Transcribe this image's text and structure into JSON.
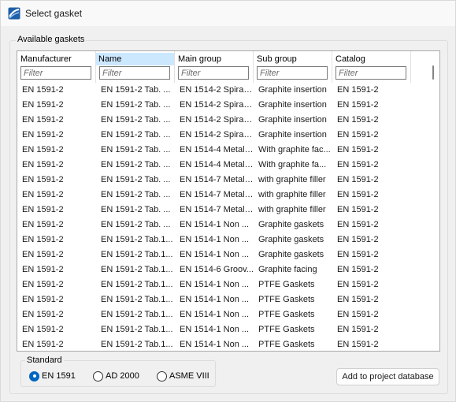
{
  "window": {
    "title": "Select gasket"
  },
  "group": {
    "label": "Available gaskets"
  },
  "columns": [
    {
      "label": "Manufacturer",
      "filter_placeholder": "Filter"
    },
    {
      "label": "Name",
      "filter_placeholder": "Filter"
    },
    {
      "label": "Main group",
      "filter_placeholder": "Filter"
    },
    {
      "label": "Sub group",
      "filter_placeholder": "Filter"
    },
    {
      "label": "Catalog",
      "filter_placeholder": "Filter"
    }
  ],
  "rows": [
    [
      "EN 1591-2",
      "EN 1591-2 Tab. ...",
      "EN 1514-2 Spiral ...",
      "Graphite insertion",
      "EN 1591-2"
    ],
    [
      "EN 1591-2",
      "EN 1591-2 Tab. ...",
      "EN 1514-2 Spiral ...",
      "Graphite insertion",
      "EN 1591-2"
    ],
    [
      "EN 1591-2",
      "EN 1591-2 Tab. ...",
      "EN 1514-2 Spiral ...",
      "Graphite insertion",
      "EN 1591-2"
    ],
    [
      "EN 1591-2",
      "EN 1591-2 Tab. ...",
      "EN 1514-2 Spiral ...",
      "Graphite insertion",
      "EN 1591-2"
    ],
    [
      "EN 1591-2",
      "EN 1591-2 Tab. ...",
      "EN 1514-4 Metal ...",
      "With graphite fac...",
      "EN 1591-2"
    ],
    [
      "EN 1591-2",
      "EN 1591-2 Tab. ...",
      "EN 1514-4 Metal ...",
      "With graphite fa...",
      "EN 1591-2"
    ],
    [
      "EN 1591-2",
      "EN 1591-2 Tab. ...",
      "EN 1514-7 Metal ...",
      "with graphite filler",
      "EN 1591-2"
    ],
    [
      "EN 1591-2",
      "EN 1591-2 Tab. ...",
      "EN 1514-7 Metal ...",
      "with graphite filler",
      "EN 1591-2"
    ],
    [
      "EN 1591-2",
      "EN 1591-2 Tab. ...",
      "EN 1514-7 Metal ...",
      "with graphite filler",
      "EN 1591-2"
    ],
    [
      "EN 1591-2",
      "EN 1591-2 Tab. ...",
      "EN 1514-1 Non ...",
      "Graphite gaskets",
      "EN 1591-2"
    ],
    [
      "EN 1591-2",
      "EN 1591-2 Tab.1...",
      "EN 1514-1 Non ...",
      "Graphite gaskets",
      "EN 1591-2"
    ],
    [
      "EN 1591-2",
      "EN 1591-2 Tab.1...",
      "EN 1514-1 Non ...",
      "Graphite gaskets",
      "EN 1591-2"
    ],
    [
      "EN 1591-2",
      "EN 1591-2 Tab.1...",
      "EN 1514-6 Groov...",
      "Graphite facing",
      "EN 1591-2"
    ],
    [
      "EN 1591-2",
      "EN 1591-2 Tab.1...",
      "EN 1514-1 Non ...",
      "PTFE Gaskets",
      "EN 1591-2"
    ],
    [
      "EN 1591-2",
      "EN 1591-2 Tab.1...",
      "EN 1514-1 Non ...",
      "PTFE Gaskets",
      "EN 1591-2"
    ],
    [
      "EN 1591-2",
      "EN 1591-2 Tab.1...",
      "EN 1514-1 Non ...",
      "PTFE Gaskets",
      "EN 1591-2"
    ],
    [
      "EN 1591-2",
      "EN 1591-2 Tab.1...",
      "EN 1514-1 Non ...",
      "PTFE Gaskets",
      "EN 1591-2"
    ],
    [
      "EN 1591-2",
      "EN 1591-2 Tab.1...",
      "EN 1514-1 Non ...",
      "PTFE Gaskets",
      "EN 1591-2"
    ]
  ],
  "standard": {
    "label": "Standard",
    "options": [
      "EN 1591",
      "AD 2000",
      "ASME VIII"
    ],
    "selected": "EN 1591"
  },
  "actions": {
    "add_label": "Add to project database"
  },
  "colors": {
    "accent": "#0067c0",
    "header_highlight": "#cce8ff"
  }
}
